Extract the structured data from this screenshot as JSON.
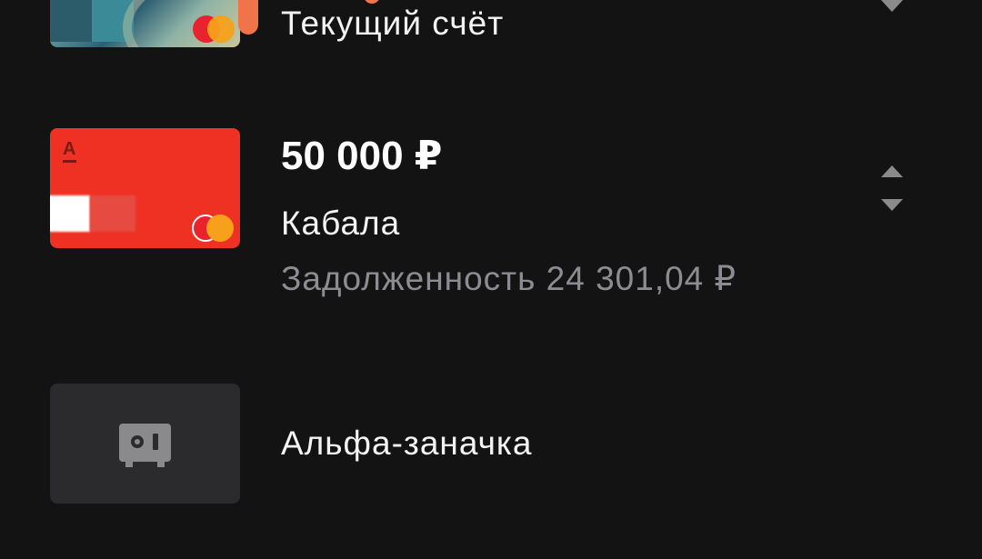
{
  "accounts": [
    {
      "name": "Текущий счёт"
    },
    {
      "amount": "50 000 ₽",
      "name": "Кабала",
      "debt": "Задолженность 24 301,04 ₽",
      "card_logo": "А"
    },
    {
      "name": "Альфа-заначка",
      "icon": "safe-icon"
    }
  ],
  "colors": {
    "background": "#131313",
    "alfa_red": "#ef3124",
    "muted_text": "#8c8c92",
    "stash_tile": "#2b2b2d"
  }
}
